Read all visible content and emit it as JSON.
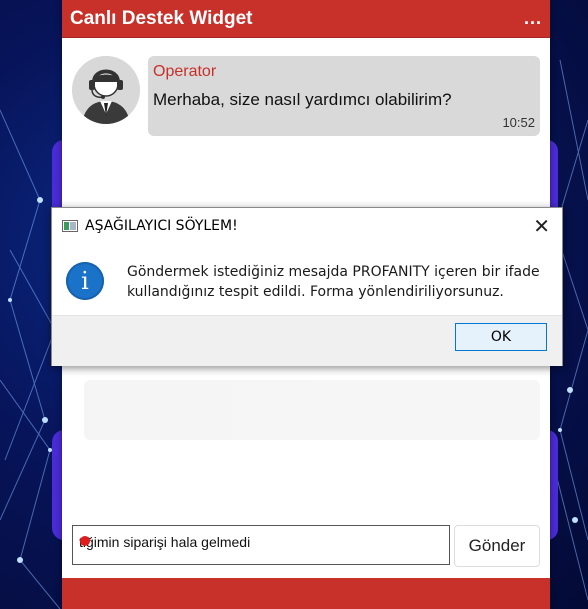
{
  "widget": {
    "title": "Canlı Destek Widget",
    "menu_label": "...",
    "header_color": "#c8302a"
  },
  "chat": {
    "messages": [
      {
        "sender": "Operator",
        "text": "Merhaba, size nasıl yardımcı olabilirim?",
        "time": "10:52",
        "avatar_icon": "headset-operator-icon"
      }
    ]
  },
  "composer": {
    "input_value": "tiğimin siparişi hala gelmedi",
    "send_label": "Gönder"
  },
  "dialog": {
    "title": "AŞAĞILAYICI SÖYLEM!",
    "message": "Göndermek istediğiniz mesajda PROFANITY içeren bir ifade kullandığınız tespit edildi. Forma yönlendiriliyorsunuz.",
    "ok_label": "OK",
    "close_symbol": "✕",
    "info_symbol": "i",
    "icon": "info-icon"
  }
}
